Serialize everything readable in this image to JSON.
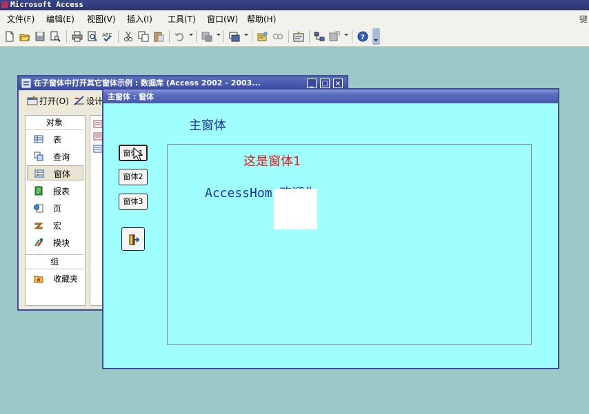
{
  "app": {
    "title": "Microsoft Access"
  },
  "menu": {
    "items": [
      "文件(F)",
      "编辑(E)",
      "视图(V)",
      "插入(I)",
      "工具(T)",
      "窗口(W)",
      "帮助(H)"
    ],
    "right_hint": "键"
  },
  "db_window": {
    "title": "在子窗体中打开其它窗体示例 : 数据库 (Access 2002 - 2003...",
    "toolbar": {
      "open": "打开(O)",
      "design": "设计"
    },
    "objects_header": "对象",
    "objects": [
      "表",
      "查询",
      "窗体",
      "报表",
      "页",
      "宏",
      "模块"
    ],
    "selected_object": "窗体",
    "groups_header": "组",
    "groups": [
      "收藏夹"
    ]
  },
  "form_window": {
    "title": "主窗体 : 窗体",
    "heading": "主窗体",
    "buttons": [
      "窗体1",
      "窗体2",
      "窗体3"
    ],
    "subform": {
      "heading": "这是窗体1",
      "text": "AccessHom 欢迎你"
    }
  },
  "colors": {
    "form_background": "#9ffefe",
    "desktop": "#9dc8c8",
    "title_bar": "#3848a0",
    "heading_blue": "#2030b0",
    "subform_red": "#e01818"
  }
}
